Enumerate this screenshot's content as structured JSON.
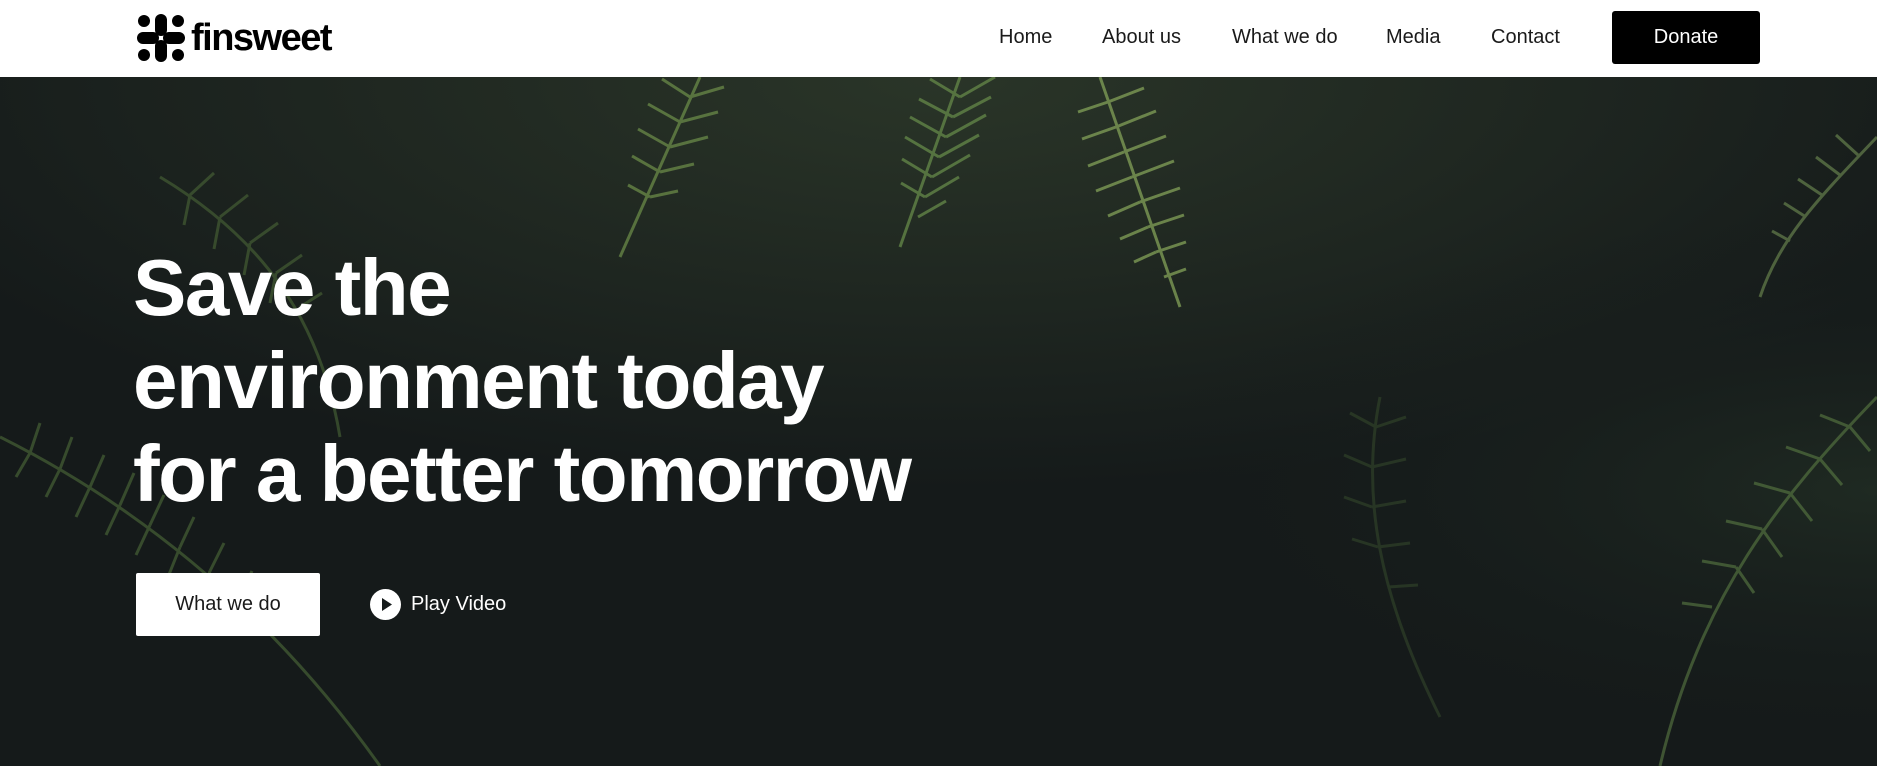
{
  "brand": {
    "name": "finsweet",
    "logo_icon": "finsweet-logo-icon"
  },
  "nav": {
    "items": [
      {
        "label": "Home"
      },
      {
        "label": "About us"
      },
      {
        "label": "What we do"
      },
      {
        "label": "Media"
      },
      {
        "label": "Contact"
      }
    ],
    "donate_label": "Donate"
  },
  "hero": {
    "title": "Save the environment today for a better tomorrow",
    "primary_button_label": "What we do",
    "video_link_label": "Play Video",
    "video_icon": "play-icon",
    "background_image": "fern-leaves-dark-forest"
  },
  "colors": {
    "nav_background": "#ffffff",
    "nav_text": "#1a1a1a",
    "donate_background": "#000000",
    "donate_text": "#ffffff",
    "hero_background": "#151a1a",
    "hero_text": "#ffffff",
    "foliage": "#4a6b3a"
  }
}
